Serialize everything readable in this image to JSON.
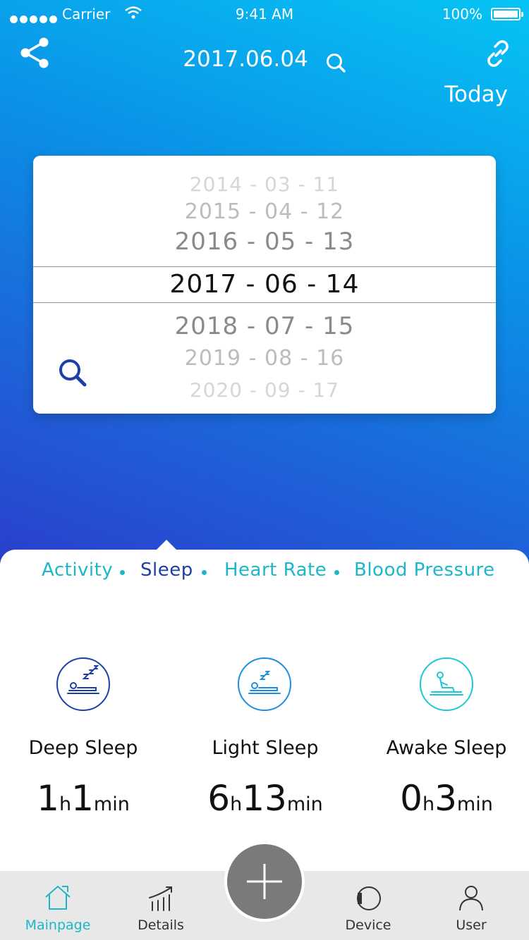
{
  "status_bar": {
    "carrier": "Carrier",
    "time": "9:41 AM",
    "battery": "100%"
  },
  "header": {
    "date": "2017.06.04",
    "today_label": "Today",
    "share_icon": "share-icon",
    "search_icon": "search-icon",
    "link_icon": "link-icon"
  },
  "picker": {
    "rows": [
      "2014 - 03 - 11",
      "2015 - 04 - 12",
      "2016 - 05 - 13",
      "2017 - 06 - 14",
      "2018 - 07 - 15",
      "2019 - 08 - 16",
      "2020 - 09 - 17"
    ],
    "selected": "2017 - 06 - 14",
    "search_icon": "search-icon"
  },
  "tabs": [
    {
      "label": "Activity"
    },
    {
      "label": "Sleep",
      "active": true
    },
    {
      "label": "Heart Rate"
    },
    {
      "label": "Blood Pressure"
    }
  ],
  "stats": [
    {
      "label": "Deep Sleep",
      "hours": "1",
      "hours_unit": "h",
      "minutes": "1",
      "minutes_unit": "min",
      "icon": "deep-sleep-icon"
    },
    {
      "label": "Light Sleep",
      "hours": "6",
      "hours_unit": "h",
      "minutes": "13",
      "minutes_unit": "min",
      "icon": "light-sleep-icon"
    },
    {
      "label": "Awake Sleep",
      "hours": "0",
      "hours_unit": "h",
      "minutes": "3",
      "minutes_unit": "min",
      "icon": "awake-icon"
    }
  ],
  "nav": [
    {
      "label": "Mainpage",
      "icon": "home-icon",
      "active": true
    },
    {
      "label": "Details",
      "icon": "chart-icon"
    },
    {
      "label": "Device",
      "icon": "device-icon"
    },
    {
      "label": "User",
      "icon": "user-icon"
    }
  ],
  "colors": {
    "accent": "#1cb7c8",
    "active_tab": "#1d3fa6",
    "hero_start": "#06c4f4",
    "hero_end": "#2a3fcc",
    "fab": "#7a7a7a"
  }
}
